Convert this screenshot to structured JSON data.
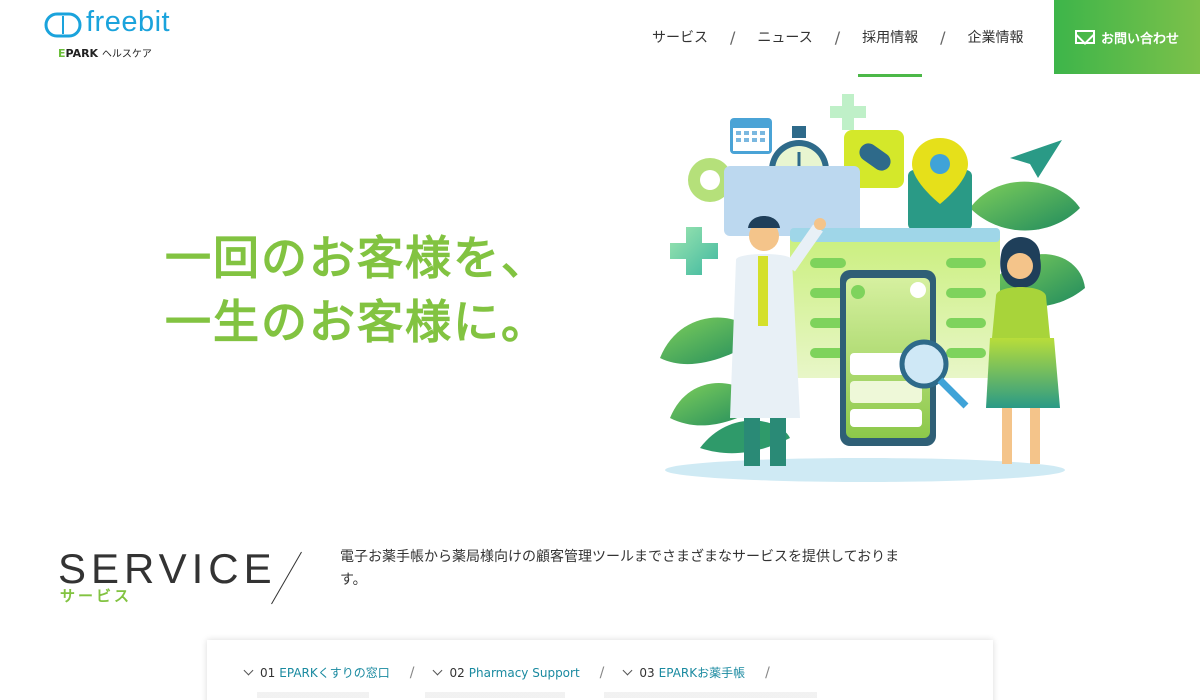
{
  "brand": {
    "name": "freebit",
    "sub_prefix": "E",
    "sub_rest": "PARK",
    "sub_suffix": "ヘルスケア"
  },
  "nav": {
    "items": [
      {
        "label": "サービス"
      },
      {
        "label": "ニュース"
      },
      {
        "label": "採用情報",
        "active": true
      },
      {
        "label": "企業情報"
      }
    ],
    "separator": "/",
    "contact_label": "お問い合わせ"
  },
  "hero": {
    "line1": "一回のお客様を、",
    "line2": "一生のお客様に。"
  },
  "service": {
    "title_en": "SERVICE",
    "title_jp": "サービス",
    "description": "電子お薬手帳から薬局様向けの顧客管理ツールまでさまざまなサービスを提供しております。"
  },
  "tabs": [
    {
      "num": "01",
      "label": "EPARKくすりの窓口"
    },
    {
      "num": "02",
      "label": "Pharmacy Support"
    },
    {
      "num": "03",
      "label": "EPARKお薬手帳"
    }
  ],
  "colors": {
    "accent_green": "#82c341",
    "brand_blue": "#1aa3dc",
    "tab_link": "#1a8aa0"
  }
}
